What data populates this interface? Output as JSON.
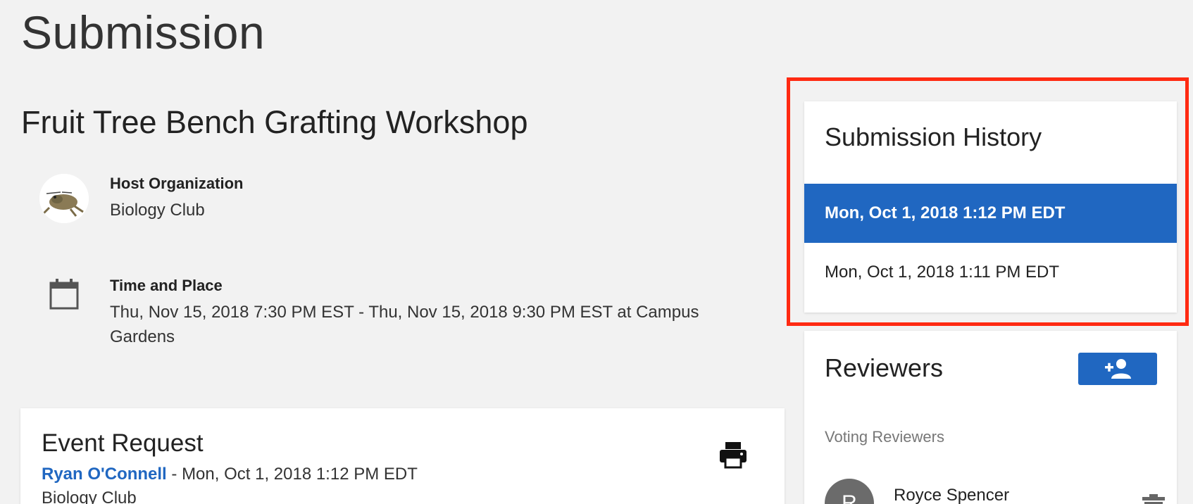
{
  "page": {
    "title": "Submission"
  },
  "event": {
    "title": "Fruit Tree Bench Grafting Workshop",
    "host_label": "Host Organization",
    "host_value": "Biology Club",
    "time_label": "Time and Place",
    "time_value": "Thu, Nov 15, 2018 7:30 PM EST - Thu, Nov 15, 2018 9:30 PM EST at Campus Gardens"
  },
  "event_request": {
    "title": "Event Request",
    "author": "Ryan O'Connell",
    "separator_date": " - Mon, Oct 1, 2018 1:12 PM EDT",
    "org": "Biology Club"
  },
  "history": {
    "title": "Submission History",
    "items": [
      {
        "label": "Mon, Oct 1, 2018 1:12 PM EDT",
        "active": true
      },
      {
        "label": "Mon, Oct 1, 2018 1:11 PM EDT",
        "active": false
      }
    ]
  },
  "reviewers": {
    "title": "Reviewers",
    "section_label": "Voting Reviewers",
    "list": [
      {
        "initial": "R",
        "name": "Royce Spencer"
      }
    ]
  },
  "colors": {
    "accent": "#2067c1",
    "highlight_border": "#ff2a12",
    "background": "#f2f2f2"
  }
}
